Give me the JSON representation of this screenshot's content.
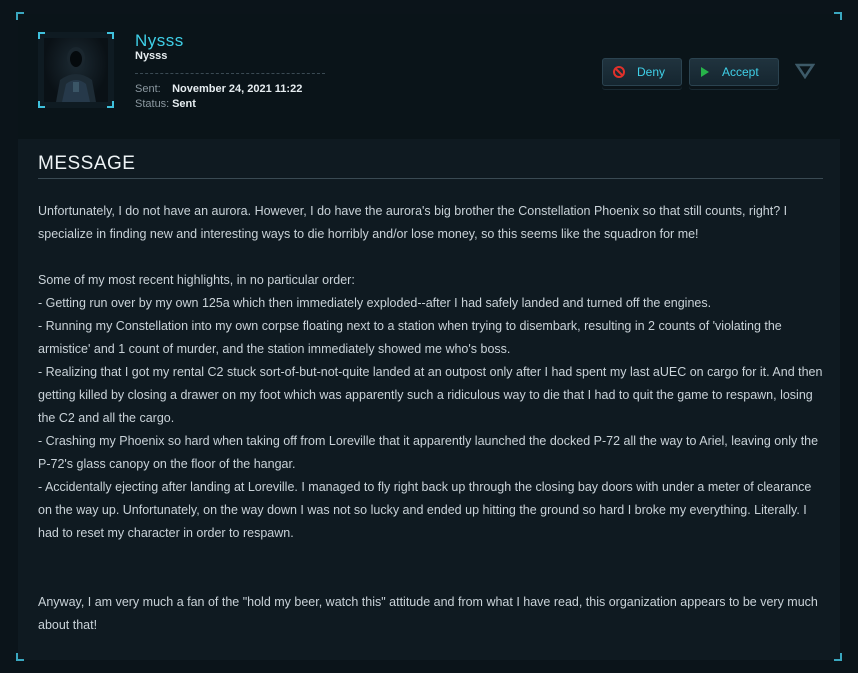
{
  "sender": {
    "handle": "Nysss",
    "nickname": "Nysss"
  },
  "meta": {
    "sent_label": "Sent:",
    "sent_value": "November 24, 2021 11:22",
    "status_label": "Status:",
    "status_value": "Sent"
  },
  "actions": {
    "deny_label": "Deny",
    "accept_label": "Accept"
  },
  "section": {
    "title": "MESSAGE"
  },
  "message": {
    "intro": "Unfortunately, I do not have an aurora. However, I do have the aurora's big brother the Constellation Phoenix so that still counts, right? I specialize in finding new and interesting ways to die horribly and/or lose money, so this seems like the squadron for me!",
    "highlights_heading": "Some of my most recent highlights, in no particular order:",
    "highlights": [
      "- Getting run over by my own 125a which then immediately exploded--after I had safely landed and turned off the engines.",
      "- Running my Constellation into my own corpse floating next to a station when trying to disembark, resulting in 2 counts of 'violating the armistice' and 1 count of murder, and the station immediately showed me who's boss.",
      "- Realizing that I got my rental C2 stuck sort-of-but-not-quite landed at an outpost only after I had spent my last aUEC on cargo for it. And then getting killed by closing a drawer on my foot which was apparently such a ridiculous way to die that I had to quit the game to respawn, losing the C2 and all the cargo.",
      "- Crashing my Phoenix so hard when taking off from Loreville that it apparently launched the docked P-72 all the way to Ariel, leaving only the P-72's glass canopy on the floor of the hangar.",
      "- Accidentally ejecting after landing at Loreville. I managed to fly right back up through the closing bay doors with under a meter of clearance on the way up. Unfortunately, on the way down I was not so lucky and ended up hitting the ground so hard I broke my everything. Literally. I had to reset my character in order to respawn."
    ],
    "closing": "Anyway, I am very much a fan of the \"hold my beer, watch this\" attitude and from what I have read, this organization appears to be very much about that!"
  },
  "colors": {
    "accent": "#3fd0e8",
    "deny_icon": "#e0312b",
    "accept_icon": "#27b34a"
  },
  "icons": {
    "deny": "no-entry-icon",
    "accept": "play-icon",
    "collapse": "chevron-down-icon"
  }
}
